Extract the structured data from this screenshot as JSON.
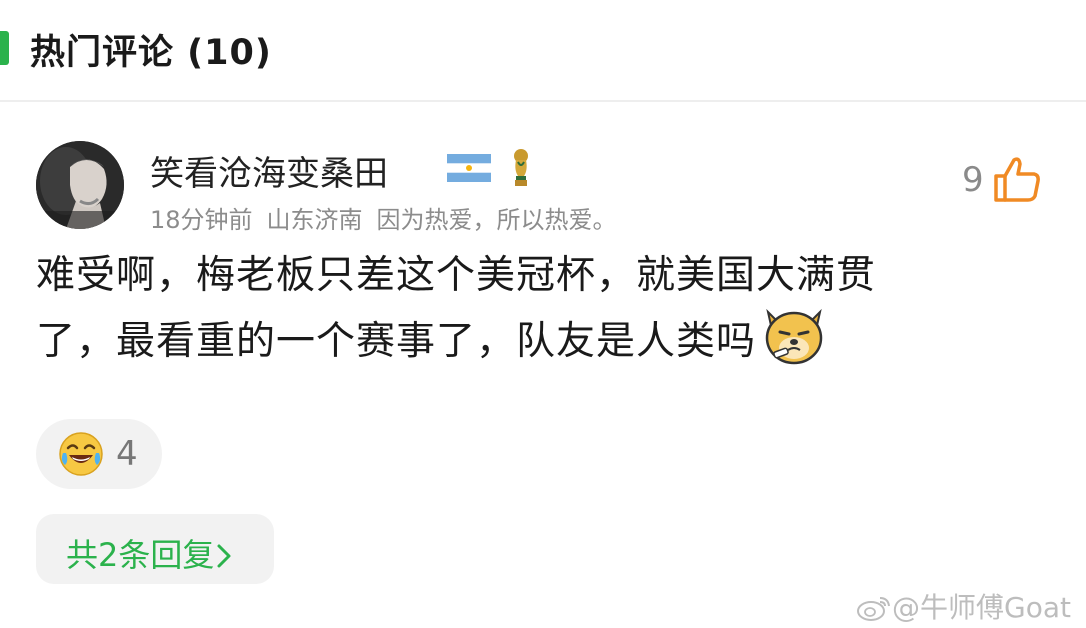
{
  "header": {
    "title": "热门评论 (10)"
  },
  "comment": {
    "username": "笑看沧海变桑田",
    "badges": [
      "argentina-flag-icon",
      "world-cup-trophy-icon"
    ],
    "time": "18分钟前",
    "location": "山东济南",
    "signature": "因为热爱，所以热爱。",
    "likes": "9",
    "line1": "难受啊，梅老板只差这个美冠杯，就美国大满贯",
    "line2": "了，最看重的一个赛事了，队友是人类吗",
    "reaction_count": "4",
    "replies_label": "共2条回复"
  },
  "watermark": {
    "text": "@牛师傅Goat"
  },
  "colors": {
    "accent": "#2bb24c",
    "like_orange": "#f08a24",
    "meta_gray": "#8c8c8c"
  }
}
